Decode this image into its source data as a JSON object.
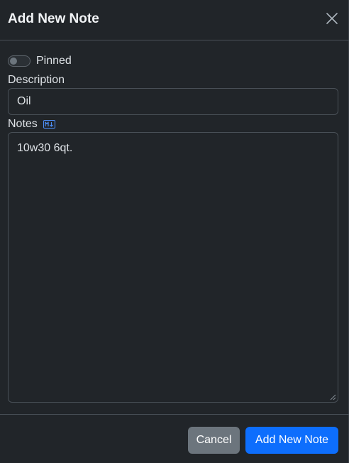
{
  "modal": {
    "title": "Add New Note"
  },
  "pinned": {
    "label": "Pinned",
    "checked": false
  },
  "description": {
    "label": "Description",
    "value": "Oil"
  },
  "notes": {
    "label": "Notes",
    "markdown_icon": "markdown-icon",
    "value": "10w30 6qt."
  },
  "footer": {
    "cancel_label": "Cancel",
    "submit_label": "Add New Note"
  },
  "colors": {
    "background": "#212529",
    "primary": "#0d6efd",
    "secondary": "#6c757d",
    "border": "#495057"
  }
}
